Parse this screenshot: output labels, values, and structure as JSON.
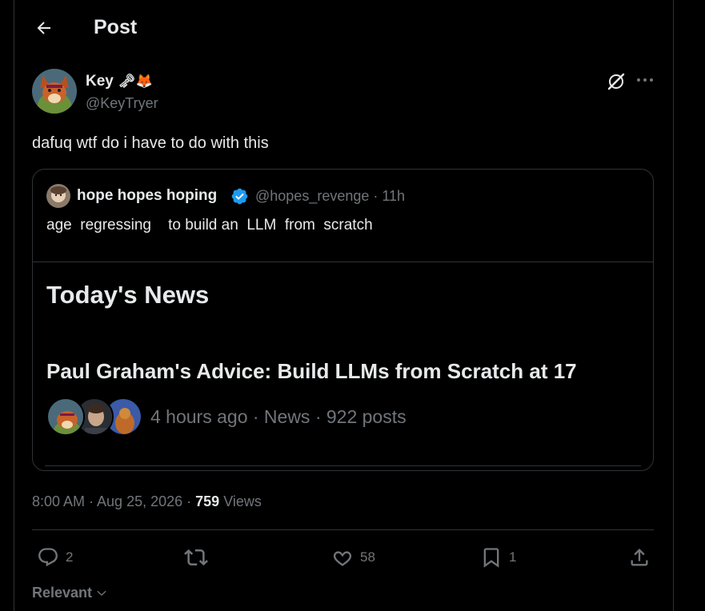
{
  "header": {
    "title": "Post"
  },
  "author": {
    "name": "Key",
    "name_emojis": "🗝🦊",
    "handle": "@KeyTryer"
  },
  "post": {
    "text": "dafuq wtf do i have to do with this"
  },
  "quote": {
    "name": "hope hopes hoping",
    "handle_time": "@hopes_revenge · 11h",
    "text": "age  regressing    to build an  LLM  from  scratch",
    "news": {
      "header": "Today's News",
      "headline": "Paul Graham's Advice: Build LLMs from Scratch at 17",
      "meta": "4 hours ago · News · 922 posts"
    }
  },
  "timestamp": {
    "time_date": "8:00 AM · Aug 25, 2026 · ",
    "views_count": "759",
    "views_label": " Views"
  },
  "actions": {
    "replies": "2",
    "likes": "58",
    "bookmarks": "1"
  },
  "sort": {
    "label": "Relevant"
  },
  "colors": {
    "background": "#000000",
    "text": "#e7e9ea",
    "muted": "#71767b",
    "border": "#2f3336",
    "verified": "#1d9bf0"
  }
}
